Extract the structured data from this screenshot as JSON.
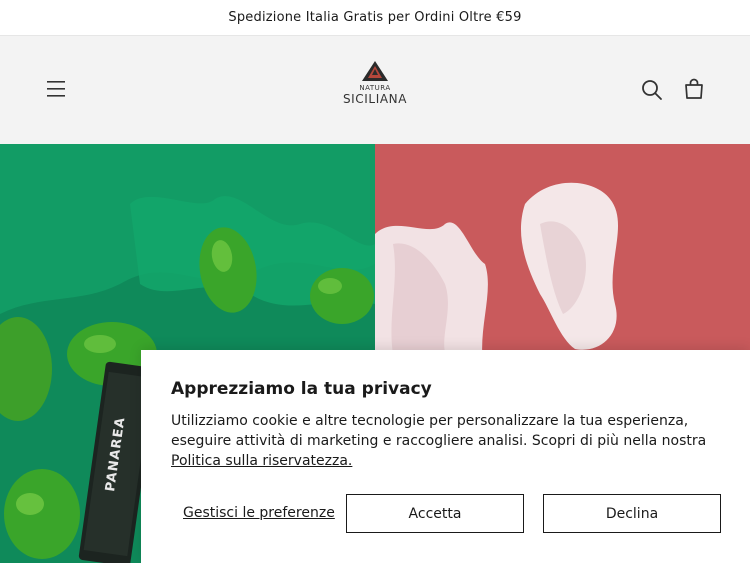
{
  "announcement": {
    "text": "Spedizione Italia Gratis per Ordini Oltre €59"
  },
  "header": {
    "logo_top": "NATURA",
    "logo_bottom": "SICILIANA",
    "menu_icon": "hamburger-menu-icon",
    "search_icon": "search-icon",
    "cart_icon": "cart-icon"
  },
  "hero": {
    "product_label": "PANAREA"
  },
  "cookie": {
    "title": "Apprezziamo la tua privacy",
    "body": "Utilizziamo cookie e altre tecnologie per personalizzare la tua esperienza, eseguire attività di marketing e raccogliere analisi. Scopri di più nella nostra",
    "policy_link": "Politica sulla riservatezza.",
    "manage_label": "Gestisci le preferenze",
    "accept_label": "Accetta",
    "decline_label": "Declina"
  },
  "colors": {
    "hero_left": "#0f8a5a",
    "hero_right": "#c95a5c",
    "header_bg": "#f3f3f3"
  }
}
